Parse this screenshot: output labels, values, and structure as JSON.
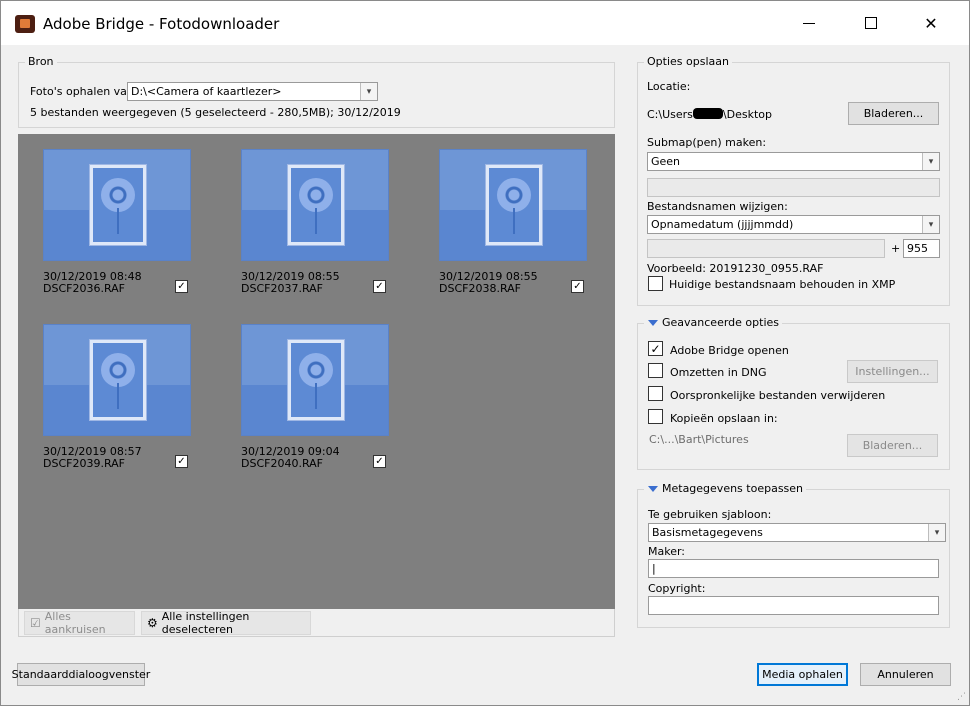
{
  "window": {
    "title": "Adobe Bridge - Fotodownloader",
    "controls": {
      "minimize": "–",
      "maximize": "□",
      "close": "✕"
    }
  },
  "source": {
    "group_title": "Bron",
    "fetch_label": "Foto's ophalen van:",
    "fetch_value": "D:\\<Camera of kaartlezer>",
    "summary": "5 bestanden weergegeven (5 geselecteerd - 280,5MB); 30/12/2019"
  },
  "thumbnails": [
    {
      "date": "30/12/2019 08:48",
      "name": "DSCF2036.RAF",
      "checked": "✓"
    },
    {
      "date": "30/12/2019 08:55",
      "name": "DSCF2037.RAF",
      "checked": "✓"
    },
    {
      "date": "30/12/2019 08:55",
      "name": "DSCF2038.RAF",
      "checked": "✓"
    },
    {
      "date": "30/12/2019 08:57",
      "name": "DSCF2039.RAF",
      "checked": "✓"
    },
    {
      "date": "30/12/2019 09:04",
      "name": "DSCF2040.RAF",
      "checked": "✓"
    }
  ],
  "thumb_toolbar": {
    "check_all": "Alles aankruisen",
    "deselect_all": "Alle instellingen deselecteren"
  },
  "save_options": {
    "group_title": "Opties opslaan",
    "location_label": "Locatie:",
    "location_prefix": "C:\\Users",
    "location_suffix": "\\Desktop",
    "browse": "Bladeren...",
    "subfolder_label": "Submap(pen) maken:",
    "subfolder_value": "Geen",
    "subfolder_extra": "",
    "rename_label": "Bestandsnamen wijzigen:",
    "rename_value": "Opnamedatum (jjjjmmdd)",
    "rename_text": "",
    "plus": "+",
    "rename_number": "955",
    "example": "Voorbeeld: 20191230_0955.RAF",
    "keep_name": "Huidige bestandsnaam behouden in XMP"
  },
  "advanced": {
    "group_title": "Geavanceerde opties",
    "open_bridge": "Adobe Bridge openen",
    "open_bridge_check": "✓",
    "convert_dng": "Omzetten in DNG",
    "settings": "Instellingen...",
    "delete_originals": "Oorspronkelijke bestanden verwijderen",
    "save_copies": "Kopieën opslaan in:",
    "copies_path": "C:\\...\\Bart\\Pictures",
    "browse": "Bladeren..."
  },
  "metadata": {
    "group_title": "Metagegevens toepassen",
    "template_label": "Te gebruiken sjabloon:",
    "template_value": "Basismetagegevens",
    "creator_label": "Maker:",
    "creator_value": "|",
    "copyright_label": "Copyright:",
    "copyright_value": ""
  },
  "footer": {
    "standard_dialog": "Standaarddialoogvenster",
    "get_media": "Media ophalen",
    "cancel": "Annuleren"
  },
  "icons": {
    "dropdown_arrow": "▾",
    "resize_grip": "⋰"
  }
}
